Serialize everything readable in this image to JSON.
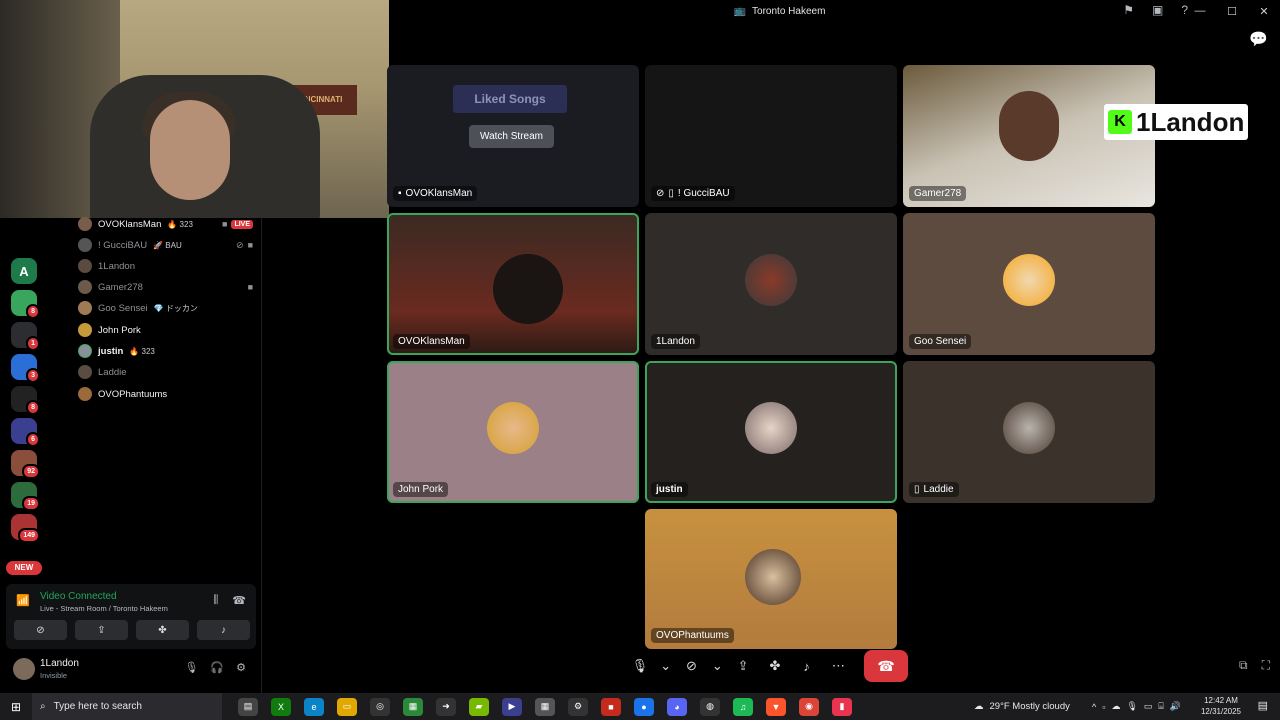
{
  "window": {
    "channel_title": "Toronto Hakeem",
    "minimize": "—",
    "maximize": "☐",
    "close": "✕"
  },
  "facecam": {
    "banner_text": "CINCINNATI"
  },
  "servers": [
    {
      "letter": "A",
      "color": "#1f7a4a",
      "badge": ""
    },
    {
      "letter": "",
      "color": "#3aa55c",
      "badge": "8"
    },
    {
      "letter": "",
      "color": "#2b2d31",
      "badge": "1"
    },
    {
      "letter": "",
      "color": "#2b6fd6",
      "badge": "3"
    },
    {
      "letter": "",
      "color": "#222",
      "badge": "8"
    },
    {
      "letter": "",
      "color": "#3a3f8f",
      "badge": "6"
    },
    {
      "letter": "",
      "color": "#8a4f3a",
      "badge": "92"
    },
    {
      "letter": "",
      "color": "#2d6b3c",
      "badge": "19"
    },
    {
      "letter": "",
      "color": "#a33",
      "badge": "149"
    }
  ],
  "new_badge": "NEW",
  "members": [
    {
      "name": "OVOKlansMan",
      "tag": "🔥 323",
      "live": "LIVE",
      "style": "bright"
    },
    {
      "name": "! GucciBAU",
      "tag": "🚀 BAU",
      "live": "",
      "style": "dim"
    },
    {
      "name": "1Landon",
      "tag": "",
      "live": "",
      "style": "dim"
    },
    {
      "name": "Gamer278",
      "tag": "",
      "live": "",
      "style": "dim"
    },
    {
      "name": "Goo Sensei",
      "tag": "💎 ドッカン",
      "live": "",
      "style": "dim"
    },
    {
      "name": "John Pork",
      "tag": "",
      "live": "",
      "style": "bright"
    },
    {
      "name": "justin",
      "tag": "🔥 323",
      "live": "",
      "style": "bright"
    },
    {
      "name": "Laddie",
      "tag": "",
      "live": "",
      "style": "dim"
    },
    {
      "name": "OVOPhantuums",
      "tag": "",
      "live": "",
      "style": "bright"
    }
  ],
  "voice": {
    "status": "Video Connected",
    "location": "Live - Stream Room / Toronto Hakeem"
  },
  "user": {
    "name": "1Landon",
    "status": "Invisible"
  },
  "tiles": {
    "t1": {
      "label": "OVOKlansMan",
      "watch": "Watch Stream",
      "liked": "Liked Songs"
    },
    "t2": {
      "label": "! GucciBAU"
    },
    "t3": {
      "label": "Gamer278"
    },
    "t4": {
      "label": "OVOKlansMan"
    },
    "t5": {
      "label": "1Landon"
    },
    "t6": {
      "label": "Goo Sensei"
    },
    "t7": {
      "label": "John Pork"
    },
    "t8": {
      "label": "justin"
    },
    "t9": {
      "label": "Laddie"
    },
    "t10": {
      "label": "OVOPhantuums"
    }
  },
  "overlay": {
    "k": "K",
    "text": "1Landon"
  },
  "taskbar": {
    "search_placeholder": "Type here to search",
    "weather": "29°F  Mostly cloudy",
    "time": "12:42 AM",
    "date": "12/31/2025"
  }
}
